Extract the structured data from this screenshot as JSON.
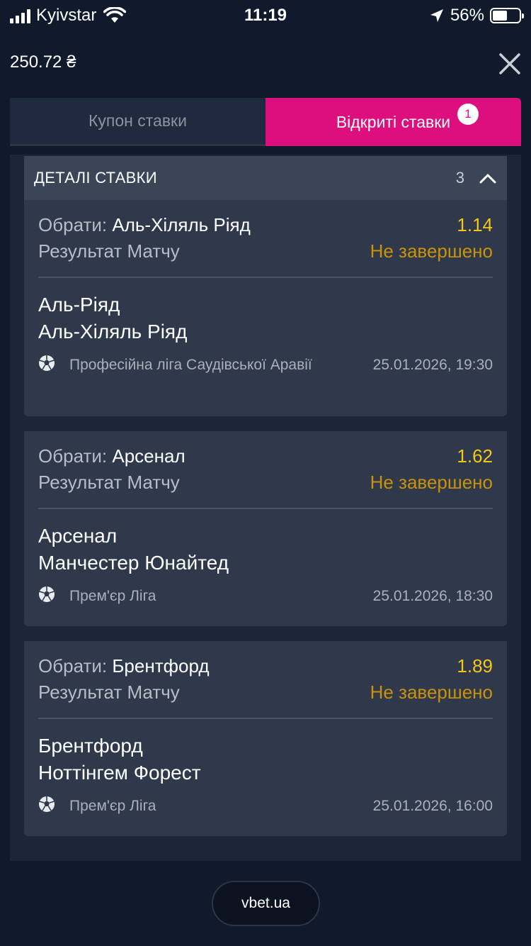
{
  "status_bar": {
    "carrier": "Kyivstar",
    "time": "11:19",
    "battery": "56%"
  },
  "balance": "250.72 ₴",
  "tabs": [
    {
      "label": "Купон ставки",
      "active": false
    },
    {
      "label": "Відкриті ставки",
      "active": true,
      "badge": "1"
    }
  ],
  "details": {
    "title": "ДЕТАЛІ СТАВКИ",
    "count": "3"
  },
  "pick_label": "Обрати:",
  "bets": [
    {
      "pick": "Аль-Хіляль Ріяд",
      "odds": "1.14",
      "market": "Результат Матчу",
      "status": "Не завершено",
      "team1": "Аль-Ріяд",
      "team2": "Аль-Хіляль Ріяд",
      "league": "Професійна ліга Саудівської Аравії",
      "date": "25.01.2026, 19:30"
    },
    {
      "pick": "Арсенал",
      "odds": "1.62",
      "market": "Результат Матчу",
      "status": "Не завершено",
      "team1": "Арсенал",
      "team2": "Манчестер Юнайтед",
      "league": "Прем'єр Ліга",
      "date": "25.01.2026, 18:30"
    },
    {
      "pick": "Брентфорд",
      "odds": "1.89",
      "market": "Результат Матчу",
      "status": "Не завершено",
      "team1": "Брентфорд",
      "team2": "Ноттінгем Форест",
      "league": "Прем'єр Ліга",
      "date": "25.01.2026, 16:00"
    }
  ],
  "footer": {
    "site": "vbet.ua"
  },
  "colors": {
    "accent": "#dd0f7e",
    "odds": "#f5c518",
    "status": "#c8920a",
    "background": "#111a2c"
  }
}
